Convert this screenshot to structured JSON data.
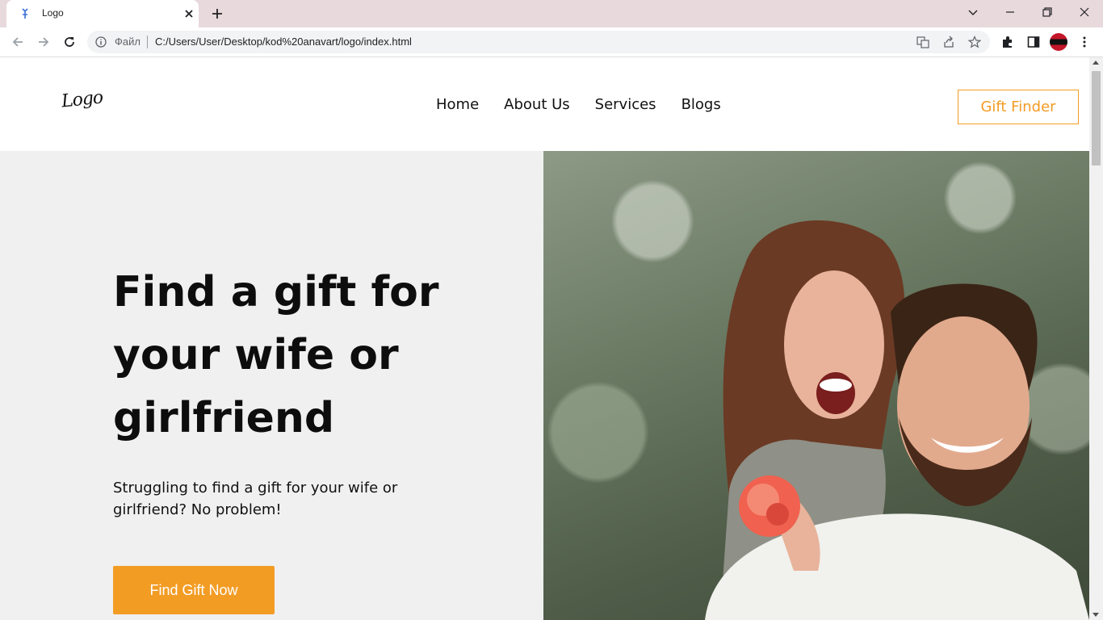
{
  "browser": {
    "tab_title": "Logo",
    "scheme_label": "Файл",
    "url": "C:/Users/User/Desktop/kod%20anavart/logo/index.html"
  },
  "site": {
    "logo_text": "Logo",
    "nav": [
      "Home",
      "About Us",
      "Services",
      "Blogs"
    ],
    "header_button": "Gift Finder",
    "hero_title": "Find a gift for your wife or girlfriend",
    "hero_subtitle": "Struggling to find a gift for your wife or girlfriend? No problem!",
    "cta_button": "Find Gift Now"
  },
  "colors": {
    "accent": "#f39c24",
    "hero_bg": "#f0f0f1",
    "tabbar_bg": "#e8d9dc"
  },
  "icons": {
    "tab_favicon": "file-icon",
    "tab_close": "close-icon",
    "new_tab": "plus-icon",
    "back": "back-arrow-icon",
    "forward": "forward-arrow-icon",
    "reload": "reload-icon",
    "info": "info-icon",
    "translate": "translate-icon",
    "share": "share-icon",
    "bookmark": "star-icon",
    "extensions": "puzzle-icon",
    "side_panel": "side-panel-icon",
    "menu": "kebab-menu-icon"
  }
}
